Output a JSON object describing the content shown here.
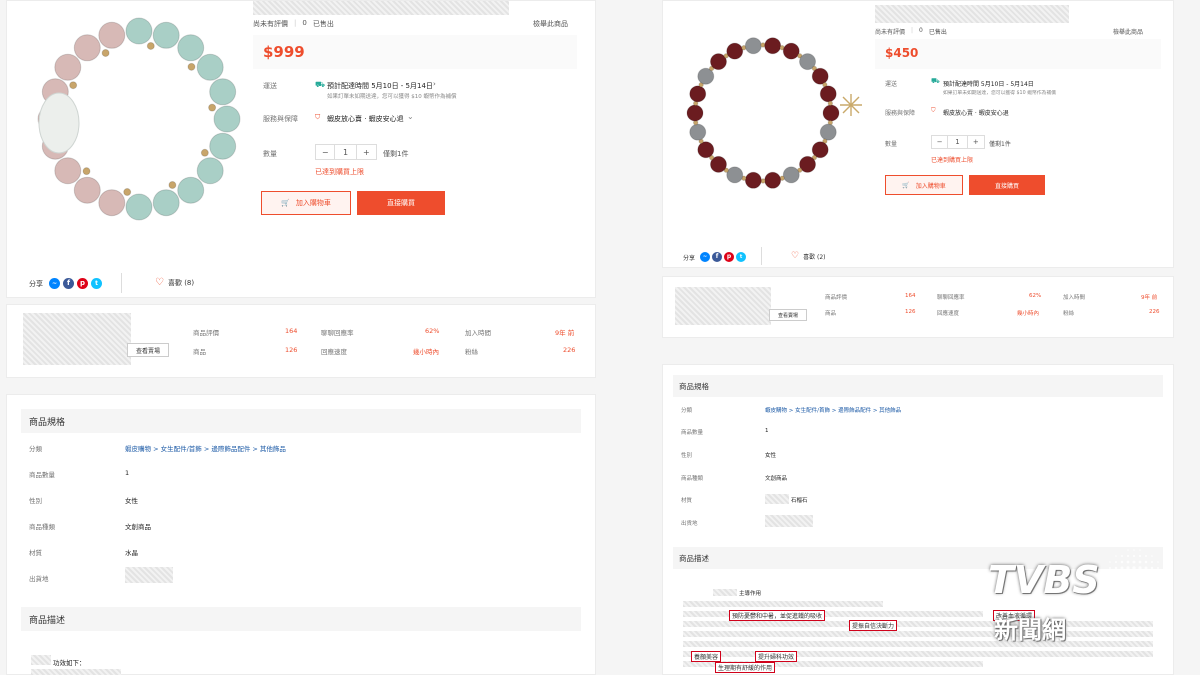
{
  "left": {
    "rating_label": "尚未有評價",
    "sold_count": "0",
    "sold_label": "已售出",
    "report_link": "檢舉此商品",
    "price": "$999",
    "shipping_label": "運送",
    "shipping_eta": "預計配達時間 5月10日 - 5月14日",
    "shipping_note": "如果訂單未如期送達，您可以獲得 $10 蝦幣作為補償",
    "service_label": "服務與保障",
    "service_value": "蝦皮放心賣 · 蝦皮安心退",
    "quantity_label": "數量",
    "quantity_value": "1",
    "quantity_limit": "僅剩1件",
    "quantity_warning": "已達到購買上限",
    "add_to_cart": "加入購物車",
    "buy_now": "直接購買",
    "share_label": "分享",
    "like_label": "喜歡 (8)",
    "shop_button": "查看賣場",
    "stats": [
      {
        "label": "商品評價",
        "value": "164"
      },
      {
        "label": "聊聊回應率",
        "value": "62%"
      },
      {
        "label": "加入時間",
        "value": "9年 前"
      },
      {
        "label": "商品",
        "value": "126"
      },
      {
        "label": "回應速度",
        "value": "幾小時內"
      },
      {
        "label": "粉絲",
        "value": "226"
      }
    ],
    "spec_title": "商品規格",
    "specs": [
      {
        "label": "分類",
        "value": "蝦皮購物 > 女生配件/首飾 > 邊際飾品配件 > 其他飾品"
      },
      {
        "label": "商品數量",
        "value": "1"
      },
      {
        "label": "性別",
        "value": "女性"
      },
      {
        "label": "商品種類",
        "value": "文創商品"
      },
      {
        "label": "材質",
        "value": "水晶"
      },
      {
        "label": "出貨地",
        "value": ""
      }
    ],
    "desc_title": "商品描述",
    "desc_first": "功效如下："
  },
  "right": {
    "rating_label": "尚未有評價",
    "sold_count": "0",
    "sold_label": "已售出",
    "report_link": "檢舉此商品",
    "price": "$450",
    "shipping_label": "運送",
    "shipping_eta": "預計配達時間 5月10日 - 5月14日",
    "shipping_note": "如果訂單未如期送達，您可以獲得 $10 蝦幣作為補償",
    "service_label": "服務與保障",
    "service_value": "蝦皮放心賣 · 蝦皮安心退",
    "quantity_label": "數量",
    "quantity_value": "1",
    "quantity_limit": "僅剩1件",
    "quantity_warning": "已達到購買上限",
    "add_to_cart": "加入購物車",
    "buy_now": "直接購買",
    "share_label": "分享",
    "like_label": "喜歡 (2)",
    "shop_button": "查看賣場",
    "stats": [
      {
        "label": "商品評價",
        "value": "164"
      },
      {
        "label": "聊聊回應率",
        "value": "62%"
      },
      {
        "label": "加入時間",
        "value": "9年 前"
      },
      {
        "label": "商品",
        "value": "126"
      },
      {
        "label": "回應速度",
        "value": "幾小時內"
      },
      {
        "label": "粉絲",
        "value": "226"
      }
    ],
    "spec_title": "商品規格",
    "specs": [
      {
        "label": "分類",
        "value": "蝦皮購物 > 女生配件/首飾 > 邊際飾品配件 > 其他飾品"
      },
      {
        "label": "商品數量",
        "value": "1"
      },
      {
        "label": "性別",
        "value": "女性"
      },
      {
        "label": "商品種類",
        "value": "文創商品"
      },
      {
        "label": "材質",
        "value": "石榴石"
      },
      {
        "label": "出貨地",
        "value": ""
      }
    ],
    "desc_title": "商品描述",
    "desc_first": "主導作用",
    "highlights": [
      "預防憂鬱和中暑，並促進鐵的吸收",
      "提振自信決斷力",
      "改善血液循環",
      "養顏美容",
      "提升婦科功效",
      "生理期有舒緩的作用"
    ]
  },
  "watermark": {
    "brand": "TVBS",
    "subtitle": "新聞網"
  },
  "colors": {
    "accent": "#ee4d2d",
    "link": "#1c5aa6"
  }
}
